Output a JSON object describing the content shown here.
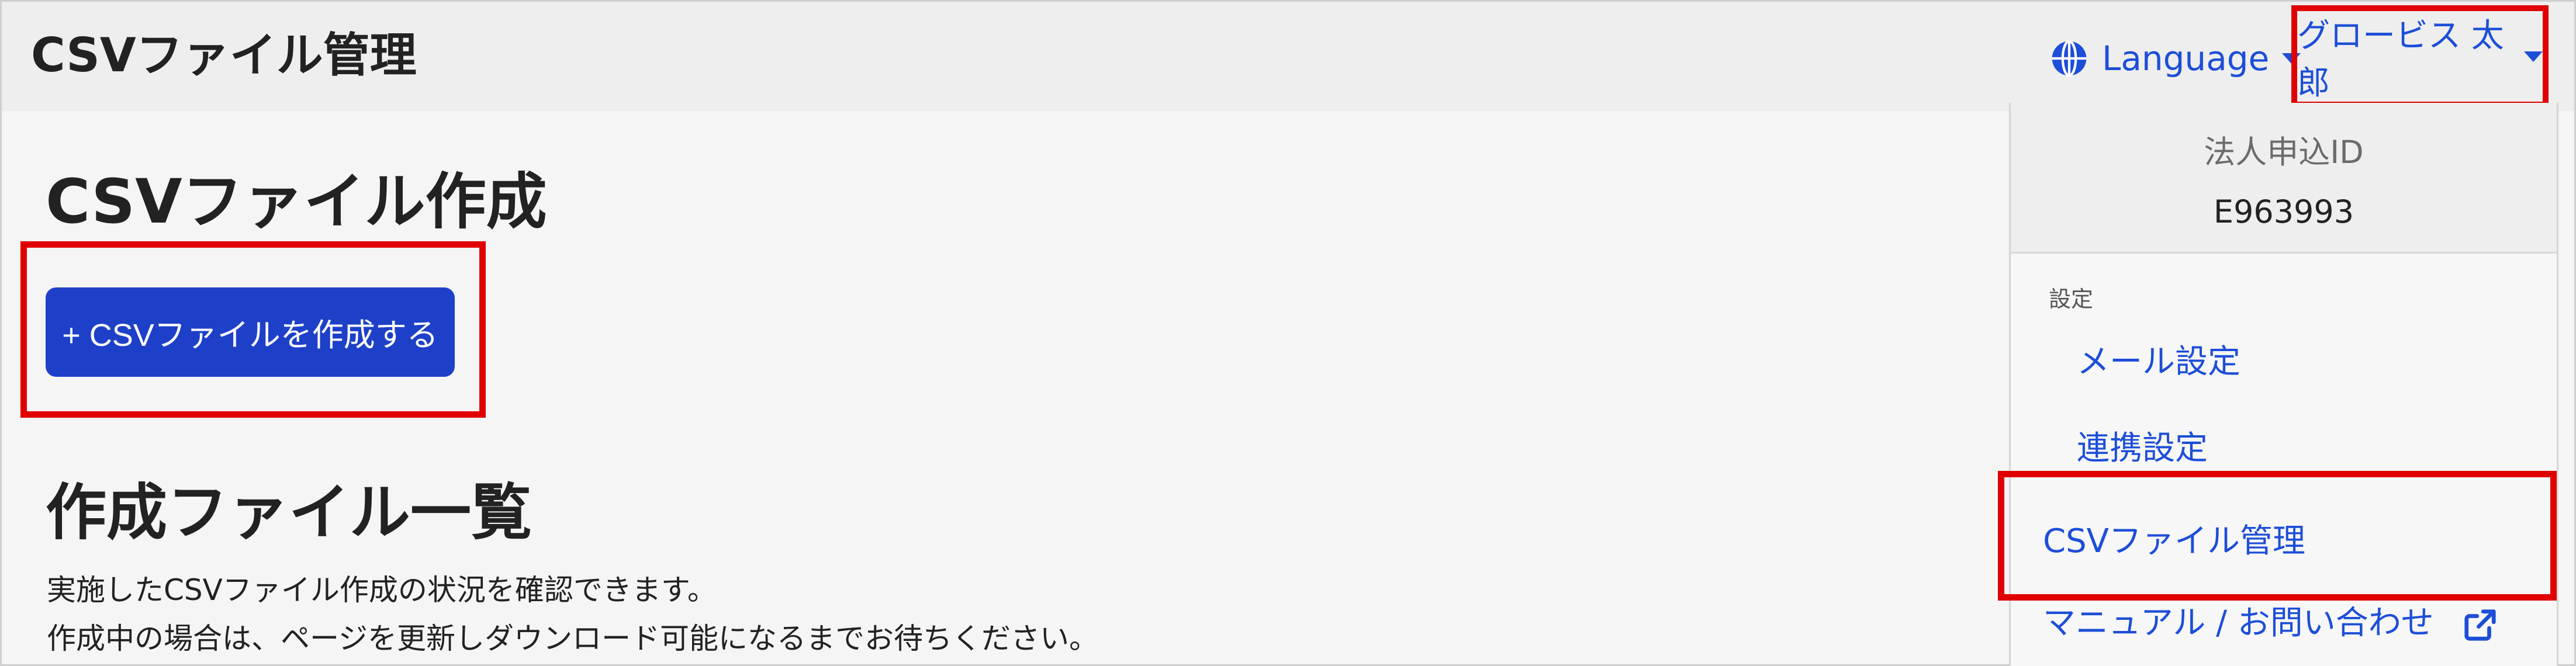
{
  "header": {
    "app_title": "CSVファイル管理",
    "language_label": "Language",
    "user_name": "グロービス 太郎"
  },
  "main": {
    "create_heading": "CSVファイル作成",
    "create_button": "+ CSVファイルを作成する",
    "list_heading": "作成ファイル一覧",
    "desc_line1": "実施したCSVファイル作成の状況を確認できます。",
    "desc_line2": "作成中の場合は、ページを更新しダウンロード可能になるまでお待ちください。"
  },
  "dropdown": {
    "corp_id_label": "法人申込ID",
    "corp_id_value": "E963993",
    "section_label": "設定",
    "items": [
      {
        "label": "メール設定"
      },
      {
        "label": "連携設定"
      },
      {
        "label": "CSVファイル管理"
      },
      {
        "label": "マニュアル / お問い合わせ"
      }
    ]
  },
  "colors": {
    "accent": "#1d4ed8",
    "highlight": "#e00000",
    "button": "#1e40c8"
  }
}
